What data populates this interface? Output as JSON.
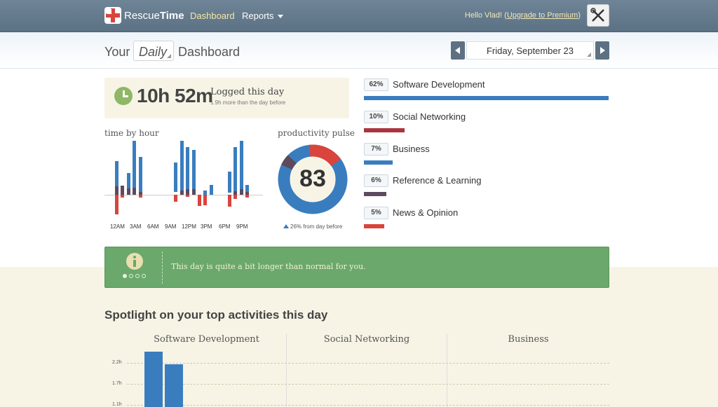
{
  "app": {
    "brand_light": "Rescue",
    "brand_bold": "Time",
    "nav_dashboard": "Dashboard",
    "nav_reports": "Reports",
    "greeting": "Hello Vlad!",
    "upgrade_link": "Upgrade to Premium",
    "tools_icon": "tools-icon"
  },
  "header": {
    "title_prefix": "Your",
    "period": "Daily",
    "title_suffix": "Dashboard",
    "date": "Friday, September 23"
  },
  "summary": {
    "total_time": "10h 52m",
    "logged_label": "Logged this day",
    "comparison": "1.9h more than the day before"
  },
  "time_by_hour": {
    "label": "time by hour",
    "ticks": [
      "12AM",
      "3AM",
      "6AM",
      "9AM",
      "12PM",
      "3PM",
      "6PM",
      "9PM"
    ]
  },
  "productivity_pulse": {
    "label": "productivity pulse",
    "score": "83",
    "change_note": "26% from day before"
  },
  "categories": [
    {
      "pct": "62%",
      "name": "Software Development",
      "color": "#3a7dbf",
      "share": 1.0
    },
    {
      "pct": "10%",
      "name": "Social Networking",
      "color": "#a83640",
      "share": 0.165
    },
    {
      "pct": "7%",
      "name": "Business",
      "color": "#3a7dbf",
      "share": 0.117
    },
    {
      "pct": "6%",
      "name": "Reference & Learning",
      "color": "#5d4a5e",
      "share": 0.092
    },
    {
      "pct": "5%",
      "name": "News & Opinion",
      "color": "#d9443c",
      "share": 0.083
    }
  ],
  "tip": {
    "text": "This day is quite a bit longer than normal for you.",
    "icon": "info-icon"
  },
  "spotlight": {
    "title": "Spotlight on your top activities this day",
    "columns": [
      "Software Development",
      "Social Networking",
      "Business"
    ],
    "yticks": [
      "2.2h",
      "1.7h",
      "1.1h"
    ]
  },
  "colors": {
    "very_productive": "#3a7dbf",
    "neutral": "#5d4a5e",
    "distracting": "#d9443c",
    "tip_bg": "#6aa86c"
  }
}
